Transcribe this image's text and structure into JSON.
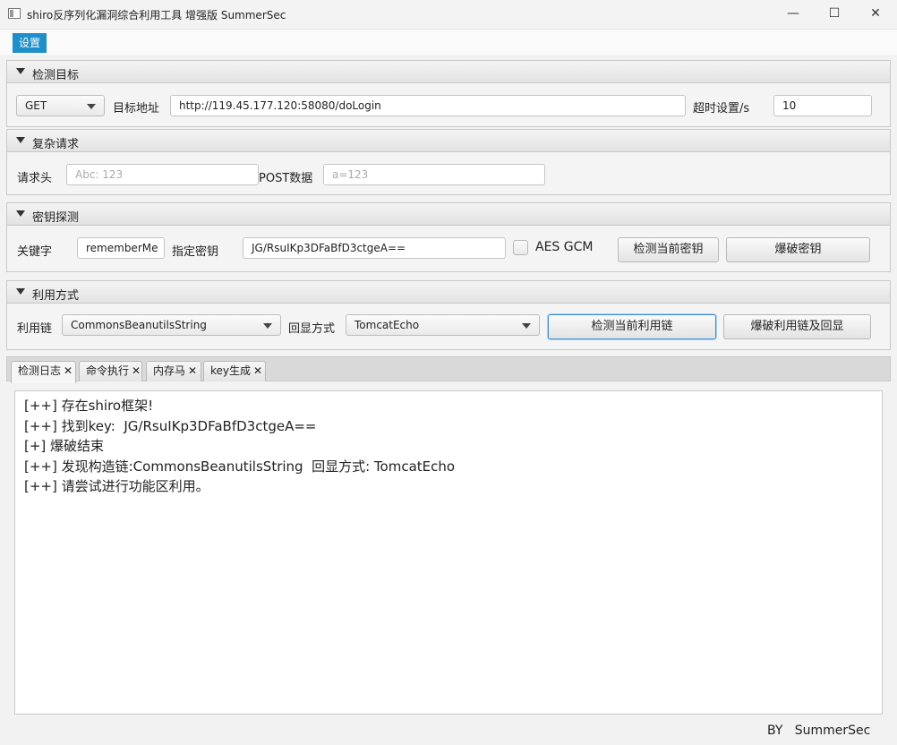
{
  "window": {
    "title": "shiro反序列化漏洞综合利用工具 增强版 SummerSec",
    "minimize_glyph": "—",
    "maximize_glyph": "☐",
    "close_glyph": "✕"
  },
  "menu": {
    "settings": "设置"
  },
  "target": {
    "header": "检测目标",
    "method": "GET",
    "url_label": "目标地址",
    "url_value": "http://119.45.177.120:58080/doLogin",
    "timeout_label": "超时设置/s",
    "timeout_value": "10"
  },
  "complex": {
    "header": "复杂请求",
    "headers_label": "请求头",
    "headers_placeholder": "Abc: 123",
    "post_label": "POST数据",
    "post_placeholder": "a=123"
  },
  "key": {
    "header": "密钥探测",
    "keyword_label": "关键字",
    "keyword_value": "rememberMe",
    "specify_label": "指定密钥",
    "key_value": "JG/RsuIKp3DFaBfD3ctgeA==",
    "aes_gcm_label": "AES GCM",
    "check_button": "检测当前密钥",
    "brute_button": "爆破密钥"
  },
  "exploit": {
    "header": "利用方式",
    "chain_label": "利用链",
    "chain_value": "CommonsBeanutilsString",
    "echo_label": "回显方式",
    "echo_value": "TomcatEcho",
    "check_button": "检测当前利用链",
    "brute_button": "爆破利用链及回显"
  },
  "tabs": [
    {
      "label": "检测日志"
    },
    {
      "label": "命令执行"
    },
    {
      "label": "内存马"
    },
    {
      "label": "key生成"
    }
  ],
  "tab_close_glyph": "✕",
  "log_lines": [
    "[++] 存在shiro框架!",
    "[++] 找到key:  JG/RsuIKp3DFaBfD3ctgeA==",
    "[+] 爆破结束",
    "[++] 发现构造链:CommonsBeanutilsString  回显方式: TomcatEcho",
    "[++] 请尝试进行功能区利用。"
  ],
  "footer": "BY   SummerSec",
  "colors": {
    "accent": "#1e8fc9",
    "focus_border": "#3a8fd6"
  }
}
